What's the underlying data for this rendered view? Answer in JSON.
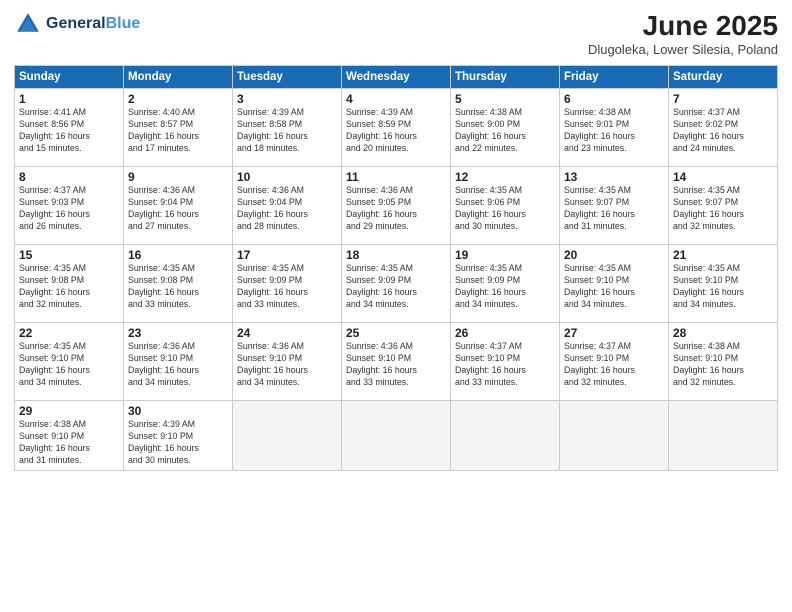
{
  "logo": {
    "line1": "General",
    "line2": "Blue"
  },
  "title": "June 2025",
  "location": "Dlugoleka, Lower Silesia, Poland",
  "weekdays": [
    "Sunday",
    "Monday",
    "Tuesday",
    "Wednesday",
    "Thursday",
    "Friday",
    "Saturday"
  ],
  "weeks": [
    [
      {
        "day": "1",
        "info": "Sunrise: 4:41 AM\nSunset: 8:56 PM\nDaylight: 16 hours\nand 15 minutes."
      },
      {
        "day": "2",
        "info": "Sunrise: 4:40 AM\nSunset: 8:57 PM\nDaylight: 16 hours\nand 17 minutes."
      },
      {
        "day": "3",
        "info": "Sunrise: 4:39 AM\nSunset: 8:58 PM\nDaylight: 16 hours\nand 18 minutes."
      },
      {
        "day": "4",
        "info": "Sunrise: 4:39 AM\nSunset: 8:59 PM\nDaylight: 16 hours\nand 20 minutes."
      },
      {
        "day": "5",
        "info": "Sunrise: 4:38 AM\nSunset: 9:00 PM\nDaylight: 16 hours\nand 22 minutes."
      },
      {
        "day": "6",
        "info": "Sunrise: 4:38 AM\nSunset: 9:01 PM\nDaylight: 16 hours\nand 23 minutes."
      },
      {
        "day": "7",
        "info": "Sunrise: 4:37 AM\nSunset: 9:02 PM\nDaylight: 16 hours\nand 24 minutes."
      }
    ],
    [
      {
        "day": "8",
        "info": "Sunrise: 4:37 AM\nSunset: 9:03 PM\nDaylight: 16 hours\nand 26 minutes."
      },
      {
        "day": "9",
        "info": "Sunrise: 4:36 AM\nSunset: 9:04 PM\nDaylight: 16 hours\nand 27 minutes."
      },
      {
        "day": "10",
        "info": "Sunrise: 4:36 AM\nSunset: 9:04 PM\nDaylight: 16 hours\nand 28 minutes."
      },
      {
        "day": "11",
        "info": "Sunrise: 4:36 AM\nSunset: 9:05 PM\nDaylight: 16 hours\nand 29 minutes."
      },
      {
        "day": "12",
        "info": "Sunrise: 4:35 AM\nSunset: 9:06 PM\nDaylight: 16 hours\nand 30 minutes."
      },
      {
        "day": "13",
        "info": "Sunrise: 4:35 AM\nSunset: 9:07 PM\nDaylight: 16 hours\nand 31 minutes."
      },
      {
        "day": "14",
        "info": "Sunrise: 4:35 AM\nSunset: 9:07 PM\nDaylight: 16 hours\nand 32 minutes."
      }
    ],
    [
      {
        "day": "15",
        "info": "Sunrise: 4:35 AM\nSunset: 9:08 PM\nDaylight: 16 hours\nand 32 minutes."
      },
      {
        "day": "16",
        "info": "Sunrise: 4:35 AM\nSunset: 9:08 PM\nDaylight: 16 hours\nand 33 minutes."
      },
      {
        "day": "17",
        "info": "Sunrise: 4:35 AM\nSunset: 9:09 PM\nDaylight: 16 hours\nand 33 minutes."
      },
      {
        "day": "18",
        "info": "Sunrise: 4:35 AM\nSunset: 9:09 PM\nDaylight: 16 hours\nand 34 minutes."
      },
      {
        "day": "19",
        "info": "Sunrise: 4:35 AM\nSunset: 9:09 PM\nDaylight: 16 hours\nand 34 minutes."
      },
      {
        "day": "20",
        "info": "Sunrise: 4:35 AM\nSunset: 9:10 PM\nDaylight: 16 hours\nand 34 minutes."
      },
      {
        "day": "21",
        "info": "Sunrise: 4:35 AM\nSunset: 9:10 PM\nDaylight: 16 hours\nand 34 minutes."
      }
    ],
    [
      {
        "day": "22",
        "info": "Sunrise: 4:35 AM\nSunset: 9:10 PM\nDaylight: 16 hours\nand 34 minutes."
      },
      {
        "day": "23",
        "info": "Sunrise: 4:36 AM\nSunset: 9:10 PM\nDaylight: 16 hours\nand 34 minutes."
      },
      {
        "day": "24",
        "info": "Sunrise: 4:36 AM\nSunset: 9:10 PM\nDaylight: 16 hours\nand 34 minutes."
      },
      {
        "day": "25",
        "info": "Sunrise: 4:36 AM\nSunset: 9:10 PM\nDaylight: 16 hours\nand 33 minutes."
      },
      {
        "day": "26",
        "info": "Sunrise: 4:37 AM\nSunset: 9:10 PM\nDaylight: 16 hours\nand 33 minutes."
      },
      {
        "day": "27",
        "info": "Sunrise: 4:37 AM\nSunset: 9:10 PM\nDaylight: 16 hours\nand 32 minutes."
      },
      {
        "day": "28",
        "info": "Sunrise: 4:38 AM\nSunset: 9:10 PM\nDaylight: 16 hours\nand 32 minutes."
      }
    ],
    [
      {
        "day": "29",
        "info": "Sunrise: 4:38 AM\nSunset: 9:10 PM\nDaylight: 16 hours\nand 31 minutes."
      },
      {
        "day": "30",
        "info": "Sunrise: 4:39 AM\nSunset: 9:10 PM\nDaylight: 16 hours\nand 30 minutes."
      },
      null,
      null,
      null,
      null,
      null
    ]
  ]
}
